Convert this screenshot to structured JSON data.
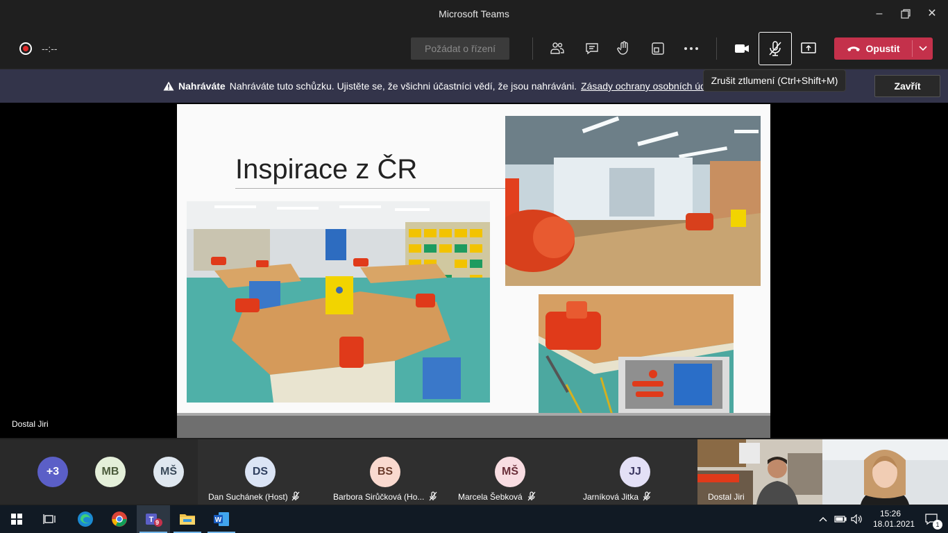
{
  "window": {
    "title": "Microsoft Teams"
  },
  "toolbar": {
    "timer": "--:--",
    "request_control": "Požádat o řízení",
    "leave": "Opustit"
  },
  "tooltip": "Zrušit ztlumení (Ctrl+Shift+M)",
  "banner": {
    "label": "Nahráváte",
    "message": "Nahráváte tuto schůzku. Ujistěte se, že všichni účastníci vědí, že jsou nahráváni.",
    "link": "Zásady ochrany osobních údajů",
    "close": "Zavřít"
  },
  "slide": {
    "title": "Inspirace z ČR"
  },
  "presenter": {
    "name": "Dostal Jiri"
  },
  "participants": {
    "overflow": "+3",
    "avatars": [
      {
        "initials": "MB",
        "color": "#e4efd9",
        "text_color": "#4a5a3a"
      },
      {
        "initials": "MŠ",
        "color": "#dfe7ef",
        "text_color": "#3a4a5a"
      }
    ],
    "tiles": [
      {
        "initials": "DS",
        "name": "Dan Suchánek (Host)",
        "color": "#dbe4f5",
        "text_color": "#2f3f5f"
      },
      {
        "initials": "BS",
        "name": "Barbora Sirůčková (Ho...",
        "color": "#f9d9cf",
        "text_color": "#6a3a2a"
      },
      {
        "initials": "MŠ",
        "name": "Marcela Šebková",
        "color": "#f8dde2",
        "text_color": "#6a2f3a"
      },
      {
        "initials": "JJ",
        "name": "Jarníková Jitka",
        "color": "#e3e0f6",
        "text_color": "#3a355f"
      }
    ],
    "video_name": "Dostal Jiri"
  },
  "taskbar": {
    "teams_badge": "9",
    "time": "15:26",
    "date": "18.01.2021",
    "notifications": "1"
  }
}
